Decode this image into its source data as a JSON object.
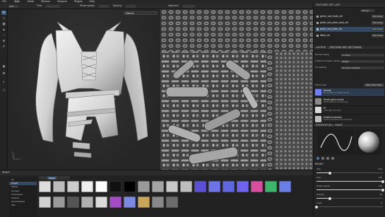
{
  "menu": {
    "items": [
      "File",
      "Edit",
      "Mode",
      "Window",
      "Viewport",
      "Plugins",
      "Help"
    ],
    "active_index": 1
  },
  "optbar": {
    "size_value": "0.22",
    "flow_label": "Flow",
    "spacing_label": "Spacing",
    "stroke_opacity_label": "Stroke opacity",
    "alignment_label": "Alignment"
  },
  "viewport": {
    "material_tab": "Material"
  },
  "texture_set_list": {
    "title": "TEXTURE SET LIST",
    "settings_label": "Settings",
    "items": [
      {
        "name": "gloves_and_boots_mtl",
        "mode": "Mat shader",
        "selected": false
      },
      {
        "name": "jacket_and_pants_extra_mtl",
        "mode": "Mat shader",
        "selected": false
      },
      {
        "name": "jacket_and_pants_mtl",
        "mode": "Mat shader",
        "selected": true
      },
      {
        "name": "Metal_mtl",
        "mode": "Mat shader",
        "selected": false
      }
    ]
  },
  "layers_panel": {
    "tabs": [
      "LAYERS",
      "TEXTURE SET SETTINGS"
    ],
    "props": [
      {
        "label": "Normal mixing",
        "value": "Combine"
      },
      {
        "label": "Ambient occlusion mixing",
        "value": "Multiply"
      },
      {
        "label": "UV padding",
        "value": "3D Space Neighbor"
      }
    ],
    "mesh_maps_label": "Mesh maps",
    "bake_button": "Bake Mesh Maps",
    "layers": [
      {
        "name": "Normal",
        "type": "Normal Map from Mesh Normal",
        "color": "#6f7ff6",
        "selected": true
      },
      {
        "name": "World space normal",
        "type": "World Space Normal (Normal)",
        "color": "#8a8a8a",
        "selected": false
      },
      {
        "name": "ID",
        "type": "Color Map from Mesh",
        "color": "#d9d9d9",
        "selected": false
      },
      {
        "name": "Ambient occlusion",
        "type": "Ambient Occlusion Map from Mesh",
        "color": "#bdbdbd",
        "selected": false
      }
    ]
  },
  "properties_panel": {
    "title": "PROPERTIES - PAINT",
    "brush_label": "BRUSH",
    "sliders": [
      {
        "label": "Size",
        "value": "0.22",
        "pct": 0.2
      },
      {
        "label": "Flow",
        "value": "100",
        "pct": 1.0
      },
      {
        "label": "Stroke opacity",
        "value": "100",
        "pct": 1.0
      },
      {
        "label": "Spacing",
        "value": "20",
        "pct": 0.2
      },
      {
        "label": "Angle",
        "value": "0",
        "pct": 0.0
      }
    ]
  },
  "shelf": {
    "title": "SHELF",
    "filter_chip": "Project",
    "categories": [
      "All",
      "Project",
      "Alphas",
      "Grunges",
      "Procedurals",
      "Textures",
      "Hard Surfaces",
      "Skin"
    ],
    "selected_category_index": 1,
    "resources_row1": [
      {
        "label": "",
        "color": "#dddddd"
      },
      {
        "label": "",
        "color": "#bbbbbb"
      },
      {
        "label": "",
        "color": "#cccccc"
      },
      {
        "label": "",
        "color": "#eeeeee"
      },
      {
        "label": "",
        "color": "#ffffff"
      },
      {
        "label": "",
        "color": "#111111"
      },
      {
        "label": "",
        "color": "#000000"
      },
      {
        "label": "",
        "color": "#9a9a9a"
      },
      {
        "label": "",
        "color": "#a5a5a5"
      },
      {
        "label": "",
        "color": "#c8c8c8"
      },
      {
        "label": "",
        "color": "#bdbdbd"
      },
      {
        "label": "",
        "color": "#5b4fd6"
      },
      {
        "label": "",
        "color": "#6d74e8"
      },
      {
        "label": "",
        "color": "#5f66e0"
      },
      {
        "label": "",
        "color": "#6e62ee"
      },
      {
        "label": "",
        "color": "#d84fa0"
      },
      {
        "label": "",
        "color": "#3db56a"
      },
      {
        "label": "",
        "color": "#6a7fe6"
      }
    ],
    "resources_row2": [
      {
        "label": "",
        "color": "#d0d0d0"
      },
      {
        "label": "",
        "color": "#9a9a9a"
      },
      {
        "label": "",
        "color": "#555555"
      },
      {
        "label": "",
        "color": "#b0b0b0"
      },
      {
        "label": "",
        "color": "#dadada"
      },
      {
        "label": "",
        "color": "#a44cc6"
      },
      {
        "label": "",
        "color": "#7a8ae0"
      },
      {
        "label": "",
        "color": "#c9a65a"
      },
      {
        "label": "",
        "color": "#888888"
      },
      {
        "label": "",
        "color": "#6c6c6c"
      }
    ]
  }
}
